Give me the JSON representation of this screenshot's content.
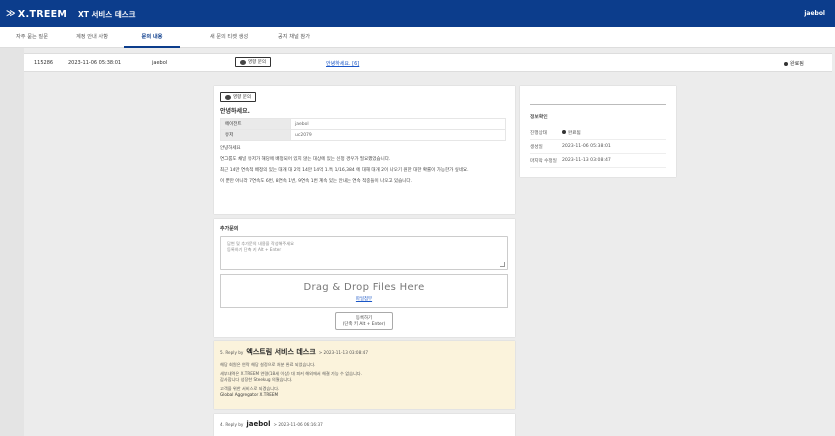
{
  "header": {
    "logo_text": "X.TREEM",
    "app_title": "XT 서비스 데스크",
    "user": "jaebol"
  },
  "tabs": [
    {
      "label": "자주 묻는 질문"
    },
    {
      "label": "계정 안내 사항"
    },
    {
      "label": "문의 내용"
    },
    {
      "label": "새 문의 티켓 생성"
    },
    {
      "label": "공지 채널 참가"
    }
  ],
  "ticket_row": {
    "id": "115286",
    "created": "2023-11-06 05:38:01",
    "user": "jaebol",
    "type": "영향 문의",
    "title": "안녕하세요. [6]",
    "status": "완료됨"
  },
  "main": {
    "type_chip": "영향 문의",
    "title": "안녕하세요.",
    "fields": [
      {
        "key": "에이전트",
        "value": "jaebol"
      },
      {
        "key": "유저",
        "value": "uc2079"
      }
    ],
    "paragraphs": [
      "안녕하세요",
      "연그룹도 채널 유저가 해당에 배정되어 있지 않는 대상에 있는 신청 경우가 필요했었습니다.",
      "최근 14만 연속적 배정의 있는 대개 대 2억 14만 14억 1.특 1/16,384 에 대해 대개 2이 나오기 원한 대한 확률이 가능한가 싶네요.",
      "이 뿐만 아니라 7연속도 6번, 8연속 1번, 9연속 1번 계속 있는 안내는 연속 적중들이 나오고 있습니다."
    ]
  },
  "side": {
    "section": "정보확인",
    "rows": [
      {
        "key": "진행상태",
        "value": "완료됨"
      },
      {
        "key": "생성일",
        "value": "2023-11-06 05:38:01"
      },
      {
        "key": "마지막 수정일",
        "value": "2023-11-13 03:08:47"
      }
    ]
  },
  "reply": {
    "title": "추가문의",
    "placeholder_line1": "답변 및 추가문의 내용을 작성해주세요",
    "placeholder_line2": "등록하기 단축 키 Alt + Enter",
    "drop_title": "Drag & Drop Files Here",
    "drop_link": "파일첨부",
    "submit_line1": "등록하기",
    "submit_line2": "(단축 키 Alt + Enter)"
  },
  "comments": [
    {
      "num_prefix": "5. Reply by",
      "author": "엑스트림 서비스 데스크",
      "time": "2023-11-13 03:08:47",
      "lines": [
        "해당 회원은 연락 해당 설정으로 처분 완료 되었습니다.",
        "",
        "세부내역은 X.TREEM 연령(18세 이상) 대 피커 해외에서 해결 가능 수 없습니다.",
        "감사합니다 성장한 Steekug 의웠습니다.",
        "",
        "고객을 위한 서비스로 되겠습니다.",
        "Global Aggregator X.TREEM"
      ]
    },
    {
      "num_prefix": "4. Reply by",
      "author": "jaebol",
      "time": "2023-11-06 06:16:37"
    }
  ]
}
